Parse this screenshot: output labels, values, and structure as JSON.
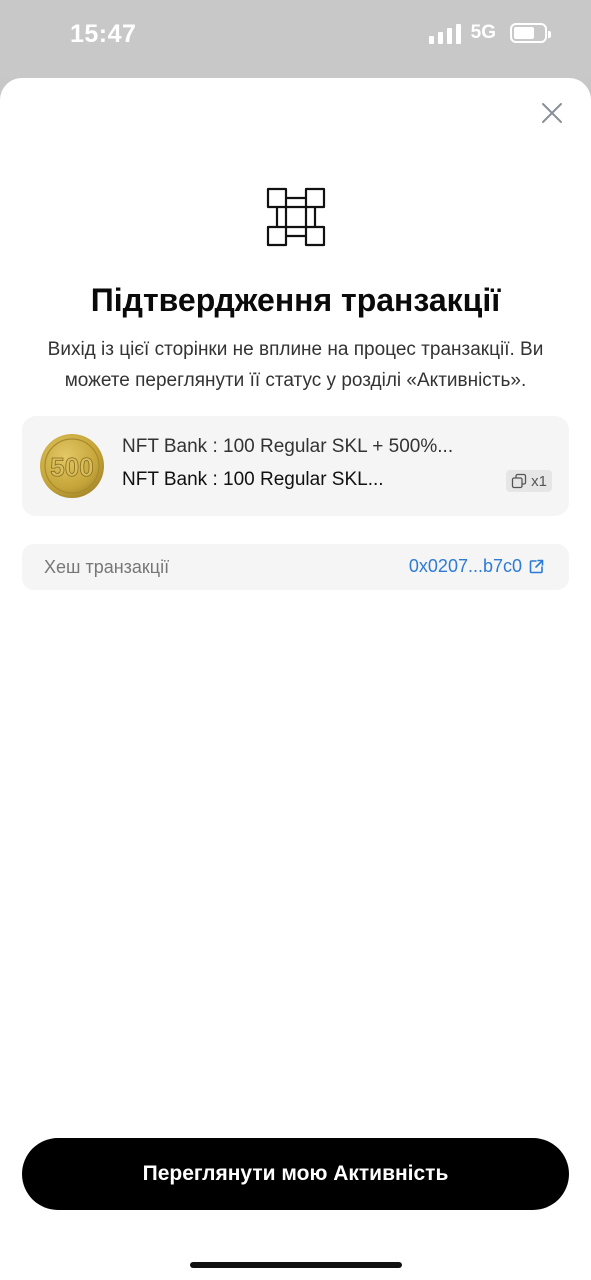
{
  "status_bar": {
    "time": "15:47",
    "network": "5G"
  },
  "sheet": {
    "title": "Підтвердження транзакції",
    "subtitle": "Вихід із цієї сторінки не вплине на процес транзакції. Ви можете переглянути її статус у розділі «Активність».",
    "nft": {
      "coin_text": "500",
      "collection_name": "NFT Bank : 100 Regular SKL + 500%...",
      "item_name": "NFT Bank : 100 Regular SKL...",
      "quantity": "x1"
    },
    "hash": {
      "label": "Хеш транзакції",
      "value": "0x0207...b7c0"
    },
    "primary_button_label": "Переглянути мою Активність"
  },
  "icons": {
    "close": "close-icon",
    "hero": "transaction-grid-icon",
    "copies": "copies-icon",
    "external_link": "external-link-icon"
  },
  "colors": {
    "link": "#2d7bd6",
    "button": "#000000",
    "card_bg": "#f5f5f5",
    "coin": "#c9a93c"
  }
}
